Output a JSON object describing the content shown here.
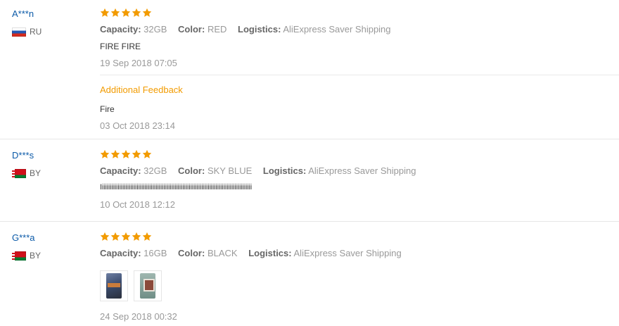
{
  "colors": {
    "username": "#0b5aa8",
    "star": "#f29b00",
    "additional_feedback": "#f29b00",
    "muted": "#999999"
  },
  "labels": {
    "capacity": "Capacity:",
    "color": "Color:",
    "logistics": "Logistics:",
    "additional_feedback": "Additional Feedback"
  },
  "reviews": [
    {
      "user": "A***n",
      "country": "RU",
      "stars": 5,
      "capacity": "32GB",
      "color": "RED",
      "logistics": "AliExpress Saver Shipping",
      "text": "FIRE FIRE",
      "date": "19 Sep 2018 07:05",
      "additional": {
        "text": "Fire",
        "date": "03 Oct 2018 23:14"
      }
    },
    {
      "user": "D***s",
      "country": "BY",
      "stars": 5,
      "capacity": "32GB",
      "color": "SKY BLUE",
      "logistics": "AliExpress Saver Shipping",
      "text": "Iiiiiiiiiiiiiiiiiiiiiiiiiiiiiiiiiiiiiiiiiiiiiiiiiiiiiiiiiiiiiiiiiiiiiiiiiiiiiiiiiiiiiiiiiiiiiiii",
      "date": "10 Oct 2018 12:12"
    },
    {
      "user": "G***a",
      "country": "BY",
      "stars": 5,
      "capacity": "16GB",
      "color": "BLACK",
      "logistics": "AliExpress Saver Shipping",
      "photos": [
        "review-photo-1",
        "review-photo-2"
      ],
      "date": "24 Sep 2018 00:32"
    }
  ]
}
